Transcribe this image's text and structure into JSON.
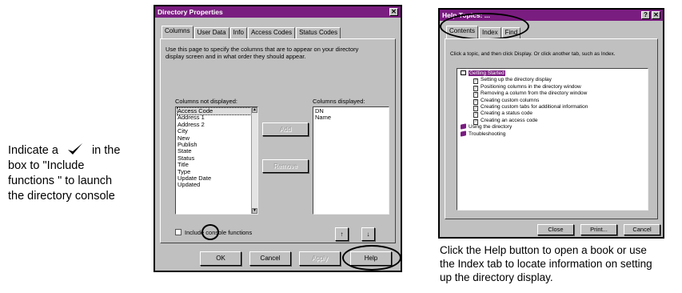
{
  "left_caption": {
    "line1_before": "Indicate a",
    "line1_after": "in the",
    "line2": "box to \"Include",
    "line3": "functions    \" to launch",
    "line4": "the directory console"
  },
  "right_caption": {
    "line1": "Click the Help button to open a book or use",
    "line2": "the Index tab to locate information on setting",
    "line3": "up the directory display."
  },
  "directory_properties": {
    "title": "Directory Properties",
    "close_glyph": "✕",
    "tabs": [
      "Columns",
      "User Data",
      "Info",
      "Access Codes",
      "Status Codes"
    ],
    "description_line1": "Use this page to specify the columns that are to appear on your directory",
    "description_line2": "display screen and in what order they should appear.",
    "not_displayed_label": "Columns not displayed:",
    "displayed_label": "Columns displayed:",
    "not_displayed_items": [
      "Access Code",
      "Address 1",
      "Address 2",
      "City",
      "New",
      "Publish",
      "State",
      "Status",
      "Title",
      "Type",
      "Update Date",
      "Updated"
    ],
    "displayed_items": [
      "DN",
      "Name"
    ],
    "add_label": "Add",
    "remove_label": "Remove",
    "include_console_label": "Include console functions",
    "up_glyph": "↑",
    "down_glyph": "↓",
    "ok_label": "OK",
    "cancel_label": "Cancel",
    "apply_label": "Apply",
    "help_label": "Help"
  },
  "help_topics": {
    "title": "Help Topics: ...",
    "help_glyph": "?",
    "close_glyph": "✕",
    "tabs": [
      "Contents",
      "Index",
      "Find"
    ],
    "instruction": "Click a topic, and then click Display. Or click another tab, such as Index.",
    "tree": [
      {
        "label": "Getting Started",
        "kind": "openbook",
        "level": 0,
        "selected": true
      },
      {
        "label": "Setting up the directory display",
        "kind": "page",
        "level": 1
      },
      {
        "label": "Positioning columns in the directory window",
        "kind": "page",
        "level": 1
      },
      {
        "label": "Removing a column from the directory window",
        "kind": "page",
        "level": 1
      },
      {
        "label": "Creating custom columns",
        "kind": "page",
        "level": 1
      },
      {
        "label": "Creating custom tabs for additional information",
        "kind": "page",
        "level": 1
      },
      {
        "label": "Creating a status code",
        "kind": "page",
        "level": 1
      },
      {
        "label": "Creating an access code",
        "kind": "page",
        "level": 1
      },
      {
        "label": "Using the directory",
        "kind": "book",
        "level": 0
      },
      {
        "label": "Troubleshooting",
        "kind": "book",
        "level": 0
      }
    ],
    "close_label": "Close",
    "print_label": "Print...",
    "cancel_label": "Cancel"
  }
}
